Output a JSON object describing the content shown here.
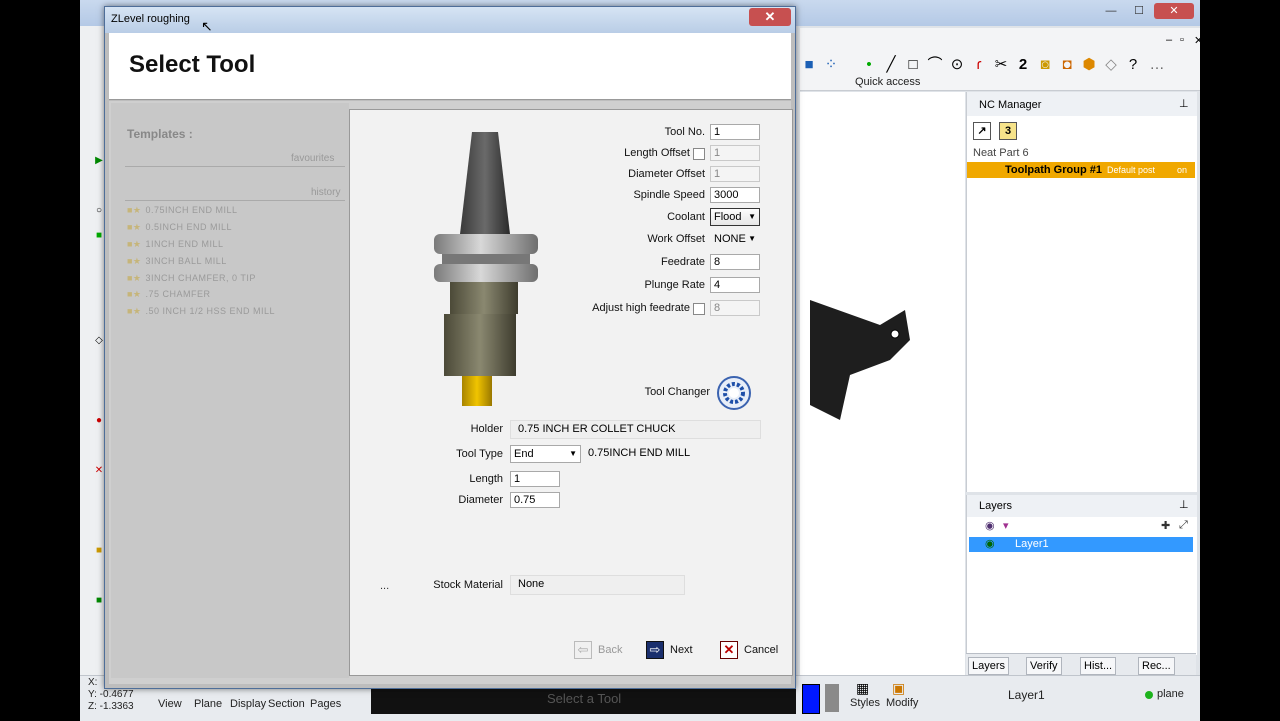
{
  "background_app": {
    "quick_access_label": "Quick access",
    "nc_manager": {
      "title": "NC Manager",
      "part_name": "Neat Part 6",
      "toolpath_group": "Toolpath Group #1",
      "post": "Default post",
      "on_label": "on",
      "tool_badge": "3"
    },
    "layers": {
      "title": "Layers",
      "layer_name": "Layer1"
    },
    "bottom_tabs": [
      "Layers",
      "Verify",
      "Hist...",
      "Rec..."
    ],
    "status_bar": {
      "coord_x": "X:",
      "coord_y": "Y: -0.4677",
      "coord_z": "Z: -1.3363",
      "menu": [
        "View",
        "Plane",
        "Display",
        "Section",
        "Pages"
      ],
      "select_prompt": "Select a Tool",
      "styles_label": "Styles",
      "modify_label": "Modify",
      "current_layer": "Layer1",
      "plane_label": "plane"
    }
  },
  "dialog": {
    "title": "ZLevel roughing",
    "heading": "Select Tool",
    "templates": {
      "title": "Templates :",
      "favourites_label": "favourites",
      "history_label": "history",
      "items": [
        "0.75INCH END MILL",
        "0.5INCH END MILL",
        "1INCH END MILL",
        "3INCH BALL MILL",
        "3INCH CHAMFER, 0 TIP",
        ".75 CHAMFER",
        ".50 INCH 1/2 HSS END MILL"
      ]
    },
    "fields": {
      "tool_no": {
        "label": "Tool No.",
        "value": "1"
      },
      "length_offset": {
        "label": "Length Offset",
        "value": "1"
      },
      "diameter_offset": {
        "label": "Diameter Offset",
        "value": "1"
      },
      "spindle_speed": {
        "label": "Spindle Speed",
        "value": "3000"
      },
      "coolant": {
        "label": "Coolant",
        "value": "Flood"
      },
      "work_offset": {
        "label": "Work Offset",
        "value": "NONE"
      },
      "feedrate": {
        "label": "Feedrate",
        "value": "8"
      },
      "plunge_rate": {
        "label": "Plunge Rate",
        "value": "4"
      },
      "adjust_high_feedrate": {
        "label": "Adjust high feedrate",
        "value": "8"
      }
    },
    "tool_changer_label": "Tool Changer",
    "holder": {
      "label": "Holder",
      "value": "0.75 INCH ER COLLET CHUCK"
    },
    "tool_type": {
      "label": "Tool Type",
      "value": "End",
      "description": "0.75INCH END MILL"
    },
    "length": {
      "label": "Length",
      "value": "1"
    },
    "diameter": {
      "label": "Diameter",
      "value": "0.75"
    },
    "ellipsis": "...",
    "stock_material": {
      "label": "Stock Material",
      "value": "None"
    },
    "buttons": {
      "back": "Back",
      "next": "Next",
      "cancel": "Cancel"
    }
  },
  "colors": {
    "nc_highlight": "#f0a800",
    "layer_selected": "#3399ff",
    "close_button": "#c75050"
  }
}
